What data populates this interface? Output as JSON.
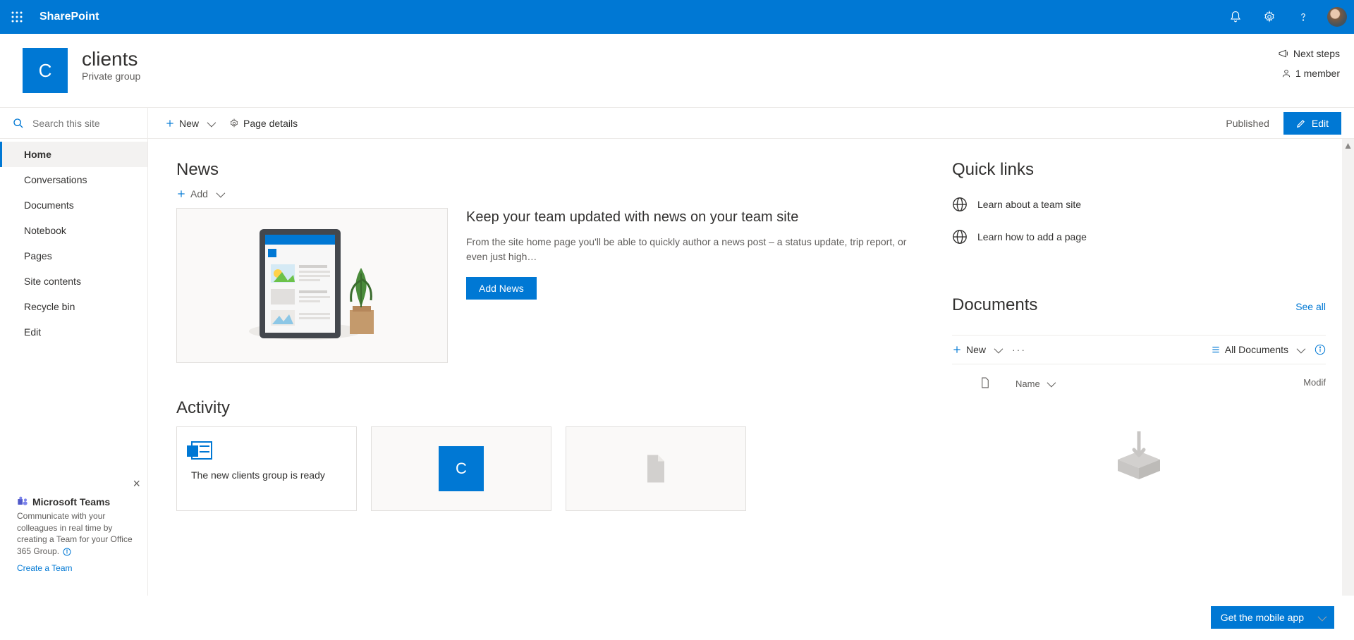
{
  "suite": {
    "app_name": "SharePoint"
  },
  "site": {
    "logo_letter": "C",
    "title": "clients",
    "subtitle": "Private group",
    "next_steps": "Next steps",
    "members": "1 member"
  },
  "search": {
    "placeholder": "Search this site"
  },
  "nav": {
    "items": [
      {
        "label": "Home",
        "active": true
      },
      {
        "label": "Conversations"
      },
      {
        "label": "Documents"
      },
      {
        "label": "Notebook"
      },
      {
        "label": "Pages"
      },
      {
        "label": "Site contents"
      },
      {
        "label": "Recycle bin"
      },
      {
        "label": "Edit"
      }
    ]
  },
  "teams_promo": {
    "title": "Microsoft Teams",
    "desc": "Communicate with your colleagues in real time by creating a Team for your Office 365 Group.",
    "link": "Create a Team"
  },
  "cmd": {
    "new": "New",
    "page_details": "Page details",
    "published": "Published",
    "edit": "Edit"
  },
  "news": {
    "heading": "News",
    "add": "Add",
    "headline": "Keep your team updated with news on your team site",
    "body": "From the site home page you'll be able to quickly author a news post – a status update, trip report, or even just high…",
    "button": "Add News"
  },
  "activity": {
    "heading": "Activity",
    "card1_text": "The new clients group is ready",
    "card2_letter": "C"
  },
  "quick_links": {
    "heading": "Quick links",
    "items": [
      {
        "label": "Learn about a team site"
      },
      {
        "label": "Learn how to add a page"
      }
    ]
  },
  "documents": {
    "heading": "Documents",
    "see_all": "See all",
    "new": "New",
    "view": "All Documents",
    "col_name": "Name",
    "col_modified": "Modif"
  },
  "mobile_app": {
    "label": "Get the mobile app"
  }
}
